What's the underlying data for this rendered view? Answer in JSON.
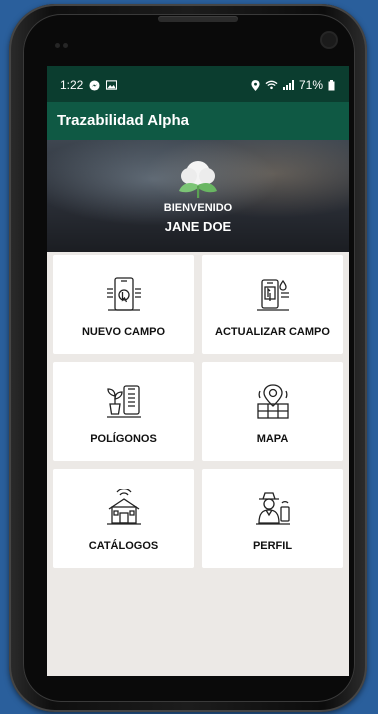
{
  "status": {
    "time": "1:22",
    "battery": "71%",
    "icons": [
      "facebook-messenger-icon",
      "image-icon",
      "location-icon",
      "wifi-icon",
      "signal-icon",
      "battery-icon"
    ]
  },
  "app": {
    "title": "Trazabilidad Alpha"
  },
  "banner": {
    "greeting": "BIENVENIDO",
    "user": "JANE DOE",
    "logo": "cotton-plant-logo"
  },
  "menu": [
    {
      "label": "NUEVO CAMPO",
      "icon": "phone-touch-icon"
    },
    {
      "label": "ACTUALIZAR CAMPO",
      "icon": "phone-update-icon"
    },
    {
      "label": "POLÍGONOS",
      "icon": "plant-phone-icon"
    },
    {
      "label": "MAPA",
      "icon": "map-pin-icon"
    },
    {
      "label": "CATÁLOGOS",
      "icon": "farm-house-icon"
    },
    {
      "label": "PERFIL",
      "icon": "farmer-icon"
    }
  ],
  "colors": {
    "statusbar": "#0b3d2f",
    "appbar": "#0f5944",
    "background": "#ece9e6"
  }
}
